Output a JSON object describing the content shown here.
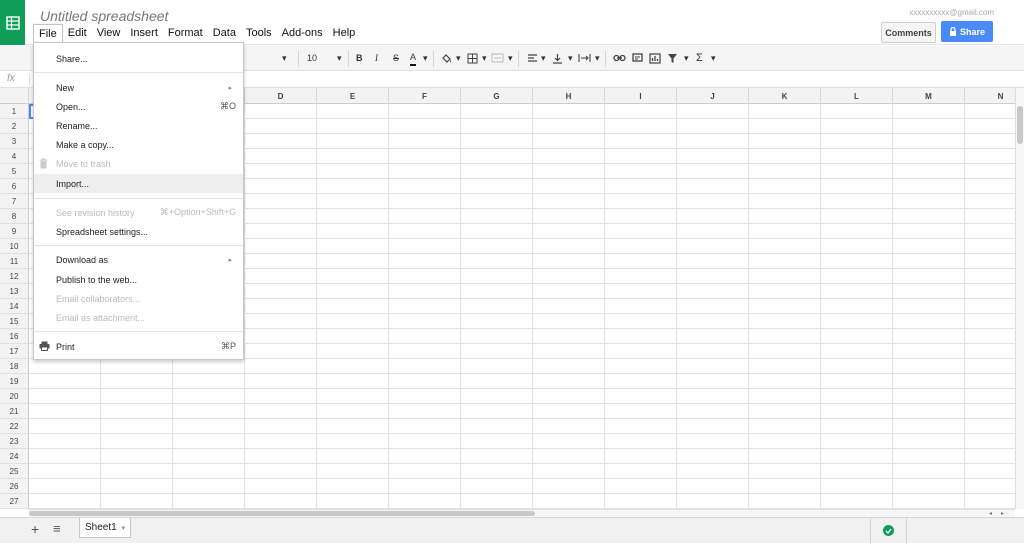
{
  "doc": {
    "title": "Untitled spreadsheet",
    "account": "xxxxxxxxxx@gmail.com"
  },
  "menubar": [
    "File",
    "Edit",
    "View",
    "Insert",
    "Format",
    "Data",
    "Tools",
    "Add-ons",
    "Help"
  ],
  "header": {
    "comments_label": "Comments",
    "share_label": "Share"
  },
  "toolbar": {
    "font_size": "10",
    "bold": "B",
    "italic": "I",
    "strike": "S",
    "text_color": "A",
    "sum": "Σ"
  },
  "fx_label": "fx",
  "columns": [
    "",
    "",
    "",
    "D",
    "E",
    "F",
    "G",
    "H",
    "I",
    "J",
    "K",
    "L",
    "M",
    "N"
  ],
  "rows": [
    "1",
    "2",
    "3",
    "4",
    "5",
    "6",
    "7",
    "8",
    "9",
    "10",
    "11",
    "12",
    "13",
    "14",
    "15",
    "16",
    "17",
    "18",
    "19",
    "20",
    "21",
    "22",
    "23",
    "24",
    "25",
    "26",
    "27"
  ],
  "file_menu": {
    "share": "Share...",
    "new": "New",
    "open": "Open...",
    "open_sc": "⌘O",
    "rename": "Rename...",
    "copy": "Make a copy...",
    "trash": "Move to trash",
    "import": "Import...",
    "revision": "See revision history",
    "revision_sc": "⌘+Option+Shift+G",
    "settings": "Spreadsheet settings...",
    "download": "Download as",
    "publish": "Publish to the web...",
    "email_collab": "Email collaborators...",
    "email_attach": "Email as attachment...",
    "print": "Print",
    "print_sc": "⌘P"
  },
  "sheets": {
    "active": "Sheet1",
    "add": "+",
    "list": "≡"
  },
  "colors": {
    "brand": "#0f9d58",
    "share": "#4a8af4",
    "saved": "#0f9d58"
  }
}
